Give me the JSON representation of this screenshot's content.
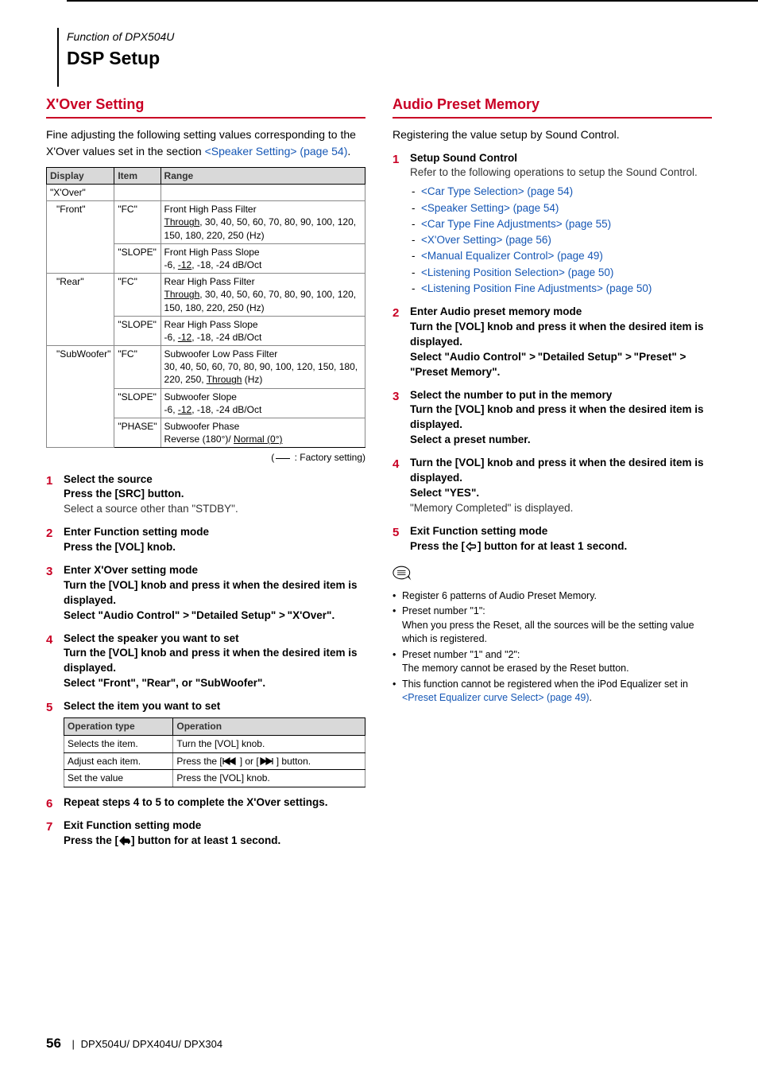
{
  "header": {
    "function_of": "Function of DPX504U",
    "title": "DSP Setup"
  },
  "left": {
    "section_title": "X'Over Setting",
    "intro_a": "Fine adjusting the following setting values corresponding to the X'Over values set in the section ",
    "intro_link": "<Speaker Setting> (page 54)",
    "intro_b": ".",
    "table_head": {
      "c1": "Display",
      "c2": "Item",
      "c3": "Range"
    },
    "rows": [
      {
        "display": "\"X'Over\"",
        "item": "",
        "range": ""
      },
      {
        "display": "\"Front\"",
        "item": "\"FC\"",
        "range_title": "Front High Pass Filter",
        "range_vals_a": ", 30, 40, 50, 60, 70, 80, 90, 100, 120, 150, 180, 220, 250 (Hz)",
        "range_u": "Through"
      },
      {
        "display": "",
        "item": "\"SLOPE\"",
        "range_title": "Front High Pass Slope",
        "range_vals_a": "-6, ",
        "range_u": "-12",
        "range_vals_b": ", -18, -24 dB/Oct"
      },
      {
        "display": "\"Rear\"",
        "item": "\"FC\"",
        "range_title": "Rear High Pass Filter",
        "range_vals_a": ", 30, 40, 50, 60, 70, 80, 90, 100, 120, 150, 180, 220, 250 (Hz)",
        "range_u": "Through"
      },
      {
        "display": "",
        "item": "\"SLOPE\"",
        "range_title": "Rear High Pass Slope",
        "range_vals_a": "-6, ",
        "range_u": "-12",
        "range_vals_b": ", -18, -24 dB/Oct"
      },
      {
        "display": "\"SubWoofer\"",
        "item": "\"FC\"",
        "range_title": "Subwoofer Low Pass Filter",
        "range_vals_a": "30, 40, 50, 60, 70, 80, 90, 100, 120, 150, 180, 220, 250, ",
        "range_u": "Through",
        "range_vals_b": " (Hz)"
      },
      {
        "display": "",
        "item": "\"SLOPE\"",
        "range_title": "Subwoofer Slope",
        "range_vals_a": "-6, ",
        "range_u": "-12",
        "range_vals_b": ", -18, -24 dB/Oct"
      },
      {
        "display": "",
        "item": "\"PHASE\"",
        "range_title": "Subwoofer Phase",
        "range_vals_a": "Reverse (180°)/ ",
        "range_u": "Normal (0°)"
      }
    ],
    "factory_note_a": "(",
    "factory_note_b": " : Factory setting)",
    "steps": [
      {
        "head": "Select the source",
        "sub": "Press the [SRC] button.",
        "note": "Select a source other than \"STDBY\"."
      },
      {
        "head": "Enter Function setting mode",
        "sub": "Press the [VOL] knob."
      },
      {
        "head": "Enter X'Over setting mode",
        "sub": "Turn the [VOL] knob and press it when the desired item is displayed.",
        "sub2a": "Select \"Audio Control\" ",
        "chev1": ">",
        "sub2b": " \"Detailed Setup\" ",
        "chev2": ">",
        "sub2c": " \"X'Over\"."
      },
      {
        "head": "Select the speaker you want to set",
        "sub": "Turn the [VOL] knob and press it when the desired item is displayed.",
        "sub2": "Select \"Front\", \"Rear\", or \"SubWoofer\"."
      },
      {
        "head": "Select the item you want to set"
      },
      {
        "head": "Repeat steps 4 to 5 to complete the X'Over settings."
      },
      {
        "head": "Exit Function setting mode",
        "sub_a": "Press the [",
        "sub_b": "] button for at least 1 second."
      }
    ],
    "op_table_head": {
      "c1": "Operation type",
      "c2": "Operation"
    },
    "op_rows": [
      {
        "c1": "Selects the item.",
        "c2": "Turn the [VOL] knob."
      },
      {
        "c1": "Adjust each item.",
        "c2a": "Press the [",
        "c2b": "] or [",
        "c2c": "] button."
      },
      {
        "c1": "Set the value",
        "c2": "Press the [VOL] knob."
      }
    ]
  },
  "right": {
    "section_title": "Audio Preset Memory",
    "intro": "Registering the value setup by Sound Control.",
    "steps": [
      {
        "head": "Setup Sound Control",
        "note": "Refer to the following operations to setup the Sound Control.",
        "links": [
          "<Car Type Selection> (page 54)",
          "<Speaker Setting> (page 54)",
          "<Car Type Fine Adjustments> (page 55)",
          "<X'Over Setting> (page 56)",
          "<Manual Equalizer Control> (page 49)",
          "<Listening Position Selection> (page 50)",
          "<Listening Position Fine Adjustments> (page 50)"
        ]
      },
      {
        "head": "Enter Audio preset memory mode",
        "sub": "Turn the [VOL] knob and press it when the desired item is displayed.",
        "sub2a": "Select \"Audio Control\" ",
        "chev1": ">",
        "sub2b": " \"Detailed Setup\" ",
        "chev2": ">",
        "sub2c": " \"Preset\" ",
        "chev3": ">",
        "sub2d": " \"Preset Memory\"."
      },
      {
        "head": "Select the number to put in the memory",
        "sub": "Turn the [VOL] knob and press it when the desired item is displayed.",
        "sub2": "Select a preset number."
      },
      {
        "head_multi": "Turn the [VOL] knob and press it when the desired item is displayed.",
        "sub": "Select \"YES\".",
        "note": "\"Memory Completed\" is displayed."
      },
      {
        "head": "Exit Function setting mode",
        "sub_a": "Press the [",
        "sub_b": "] button for at least 1 second."
      }
    ],
    "bullets": [
      {
        "t": "Register 6 patterns of Audio Preset Memory."
      },
      {
        "t": "Preset number \"1\":",
        "cont": "When you press the Reset, all the sources will be the setting value which is registered."
      },
      {
        "t": "Preset number \"1\" and \"2\":",
        "cont": "The memory cannot be erased by the Reset button."
      },
      {
        "t": "This function cannot be registered when the iPod Equalizer set in ",
        "link": "<Preset Equalizer curve Select> (page 49)",
        "t2": "."
      }
    ]
  },
  "footer": {
    "page": "56",
    "models": "DPX504U/ DPX404U/ DPX304"
  }
}
